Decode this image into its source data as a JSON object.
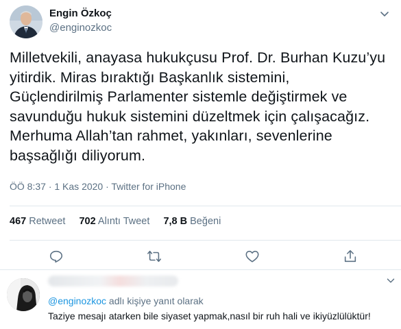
{
  "author": {
    "name": "Engin Özkoç",
    "handle": "@enginozkoc"
  },
  "tweet": {
    "lines": [
      "Milletvekili, anayasa hukukçusu Prof. Dr. Burhan Kuzu’yu",
      "yitirdik. Miras bıraktığı Başkanlık sistemini,",
      "Güçlendirilmiş Parlamenter sistemle değiştirmek ve",
      "savunduğu hukuk sistemini düzeltmek için çalışacağız.",
      "Merhuma Allah’tan rahmet, yakınları, sevenlerine",
      "başsağlığı diliyorum."
    ],
    "time": "ÖÖ 8:37",
    "date": "1 Kas 2020",
    "source": "Twitter for iPhone",
    "separator": "·"
  },
  "stats": {
    "retweets_count": "467",
    "retweets_label": "Retweet",
    "quotes_count": "702",
    "quotes_label": "Alıntı Tweet",
    "likes_count": "7,8 B",
    "likes_label": "Beğeni"
  },
  "reply": {
    "replying_mention": "@enginozkoc",
    "replying_suffix": " adlı kişiye yanıt olarak",
    "text": "Taziye mesajı atarken bile siyaset yapmak,nasıl bir ruh hali ve ikiyüzlülüktür!"
  },
  "icons": {
    "reply": "reply-icon",
    "retweet": "retweet-icon",
    "like": "like-icon",
    "share": "share-icon",
    "more": "chevron-down-icon"
  },
  "colors": {
    "text": "#0f1419",
    "secondary": "#5b7083",
    "link": "#1b95e0",
    "divider": "#e1e8ed"
  }
}
